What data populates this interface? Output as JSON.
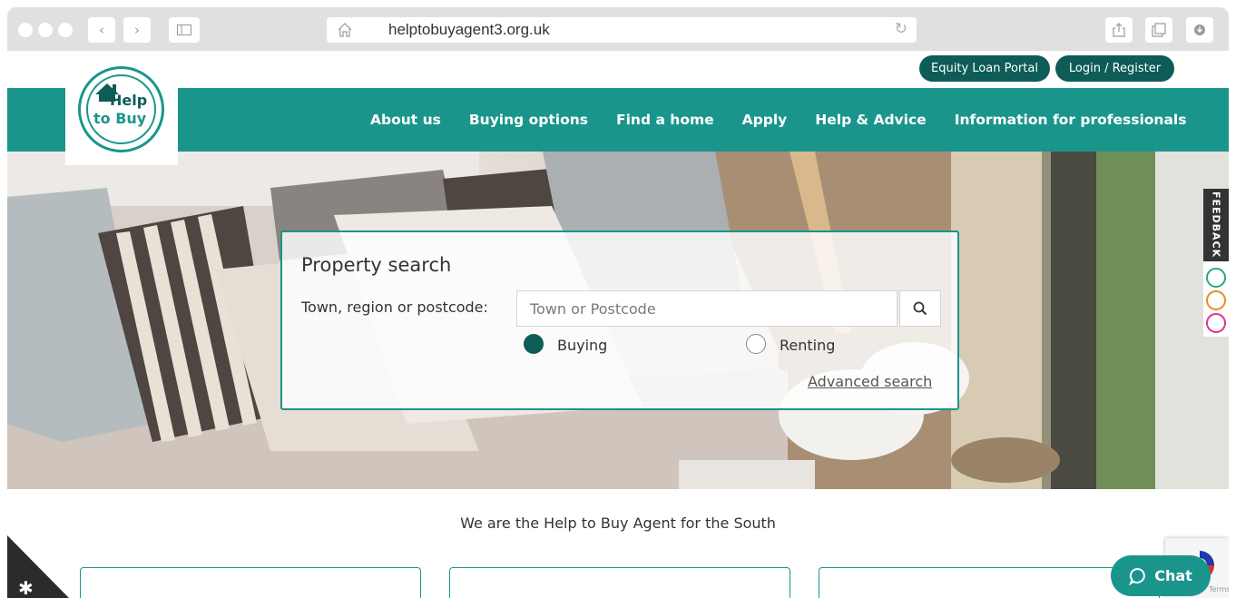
{
  "browser": {
    "url": "helptobuyagent3.org.uk",
    "back_glyph": "‹",
    "forward_glyph": "›"
  },
  "header": {
    "logo_text_line1": "Help",
    "logo_text_line2": "to Buy",
    "top_links": [
      {
        "label": "Equity Loan Portal"
      },
      {
        "label": "Login / Register"
      }
    ],
    "nav": [
      {
        "label": "About us"
      },
      {
        "label": "Buying options"
      },
      {
        "label": "Find a home"
      },
      {
        "label": "Apply"
      },
      {
        "label": "Help & Advice"
      },
      {
        "label": "Information for professionals"
      }
    ]
  },
  "search": {
    "title": "Property search",
    "location_label": "Town, region or postcode:",
    "placeholder": "Town or Postcode",
    "options": [
      {
        "label": "Buying",
        "selected": true
      },
      {
        "label": "Renting",
        "selected": false
      }
    ],
    "advanced_link": "Advanced search"
  },
  "feedback": {
    "label": "FEEDBACK"
  },
  "main": {
    "tagline": "We are the Help to Buy Agent for the South"
  },
  "chat": {
    "label": "Chat"
  },
  "recaptcha": {
    "terms": "Terms"
  },
  "colors": {
    "brand": "#1a958c",
    "brand_dark": "#0d5c58",
    "happy": "#2aa58a",
    "neutral": "#f08a24",
    "sad": "#e0338a"
  }
}
